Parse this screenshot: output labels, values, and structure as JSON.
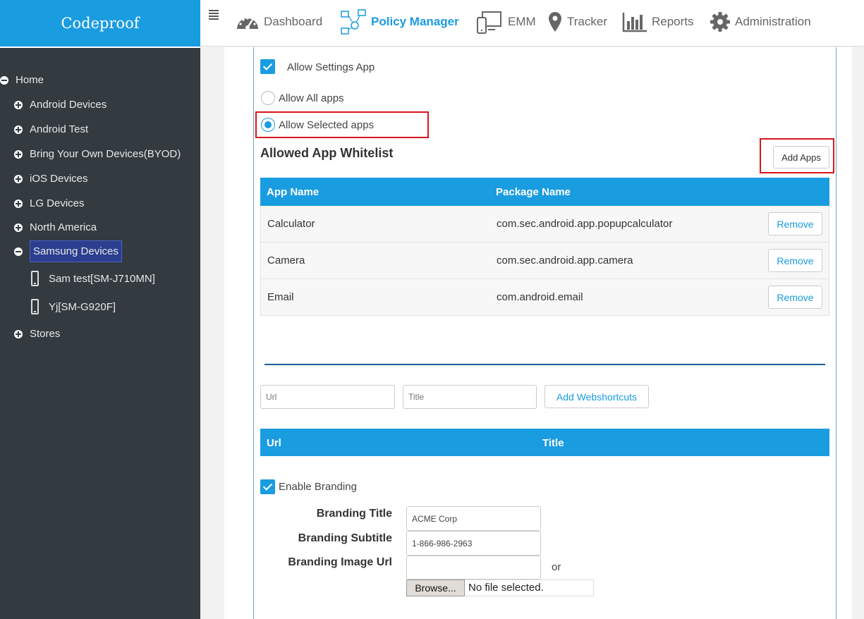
{
  "brand": "Codeproof",
  "nav": {
    "dashboard": "Dashboard",
    "policy_manager": "Policy Manager",
    "emm": "EMM",
    "tracker": "Tracker",
    "reports": "Reports",
    "administration": "Administration"
  },
  "sidebar": {
    "root": "Home",
    "groups": [
      "Android Devices",
      "Android Test",
      "Bring Your Own Devices(BYOD)",
      "iOS Devices",
      "LG Devices",
      "North America",
      "Samsung Devices",
      "Stores"
    ],
    "devices": [
      "Sam test[SM-J710MN]",
      "Yj[SM-G920F]"
    ]
  },
  "settings": {
    "allow_settings_app": "Allow Settings App",
    "allow_all_apps": "Allow All apps",
    "allow_selected_apps": "Allow Selected apps"
  },
  "whitelist": {
    "title": "Allowed App Whitelist",
    "add_button": "Add Apps",
    "columns": [
      "App Name",
      "Package Name"
    ],
    "rows": [
      {
        "name": "Calculator",
        "package": "com.sec.android.app.popupcalculator",
        "action": "Remove"
      },
      {
        "name": "Camera",
        "package": "com.sec.android.app.camera",
        "action": "Remove"
      },
      {
        "name": "Email",
        "package": "com.android.email",
        "action": "Remove"
      }
    ]
  },
  "webshortcuts": {
    "url_placeholder": "Url",
    "title_placeholder": "Title",
    "add_button": "Add Webshortcuts",
    "columns": [
      "Url",
      "Title"
    ]
  },
  "branding": {
    "enable_label": "Enable Branding",
    "title_label": "Branding Title",
    "title_value": "ACME Corp",
    "subtitle_label": "Branding Subtitle",
    "subtitle_value": "1-866-986-2963",
    "image_label": "Branding Image Url",
    "image_value": "",
    "or": "or",
    "browse": "Browse...",
    "no_file": "No file selected."
  },
  "colors": {
    "accent": "#1a9ce0",
    "sidebar": "#333a40",
    "highlight": "#d9141e"
  }
}
